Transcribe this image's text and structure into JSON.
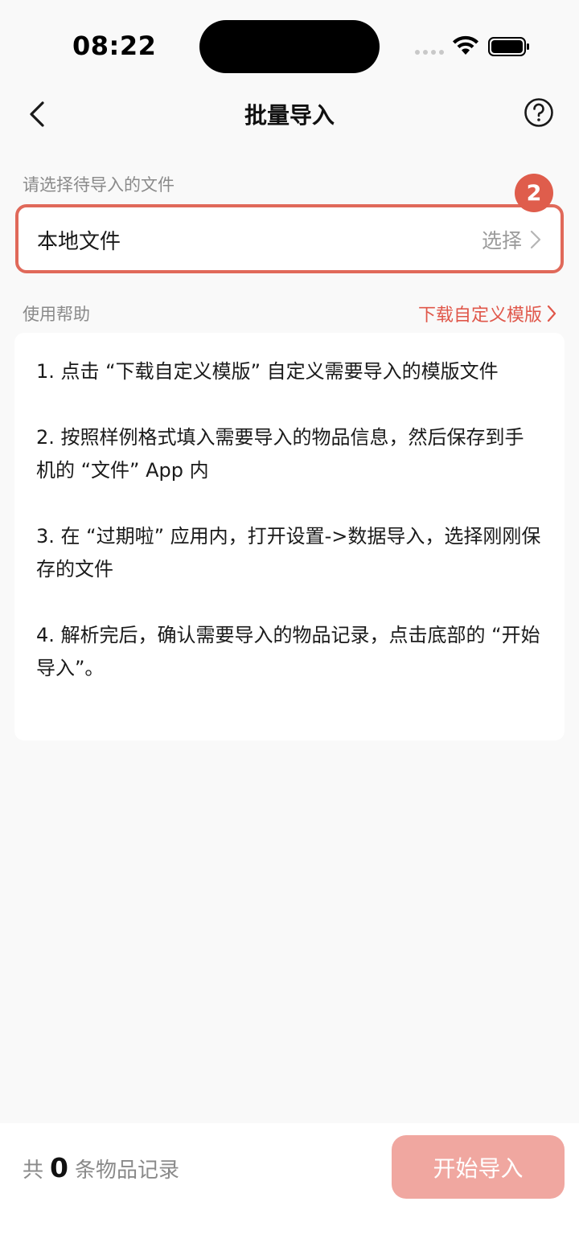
{
  "status_bar": {
    "time": "08:22"
  },
  "nav": {
    "title": "批量导入"
  },
  "file_section": {
    "label": "请选择待导入的文件",
    "badge": "2",
    "item_label": "本地文件",
    "action_label": "选择"
  },
  "help_section": {
    "label": "使用帮助",
    "template_link": "下载自定义模版",
    "steps": [
      "1. 点击 “下载自定义模版” 自定义需要导入的模版文件",
      "2. 按照样例格式填入需要导入的物品信息，然后保存到手机的 “文件” App 内",
      "3. 在 “过期啦” 应用内，打开设置->数据导入，选择刚刚保存的文件",
      "4. 解析完后，确认需要导入的物品记录，点击底部的 “开始导入”。"
    ]
  },
  "bottom_bar": {
    "count_prefix": "共",
    "count_value": "0",
    "count_suffix": "条物品记录",
    "start_button": "开始导入"
  },
  "colors": {
    "accent": "#e0574a",
    "badge": "#df5d4c",
    "button_disabled": "#f0a7a0",
    "background": "#f9f9f9"
  },
  "icons": [
    "back-arrow-icon",
    "help-icon",
    "chevron-right-icon",
    "wifi-icon",
    "battery-icon",
    "signal-icon"
  ]
}
